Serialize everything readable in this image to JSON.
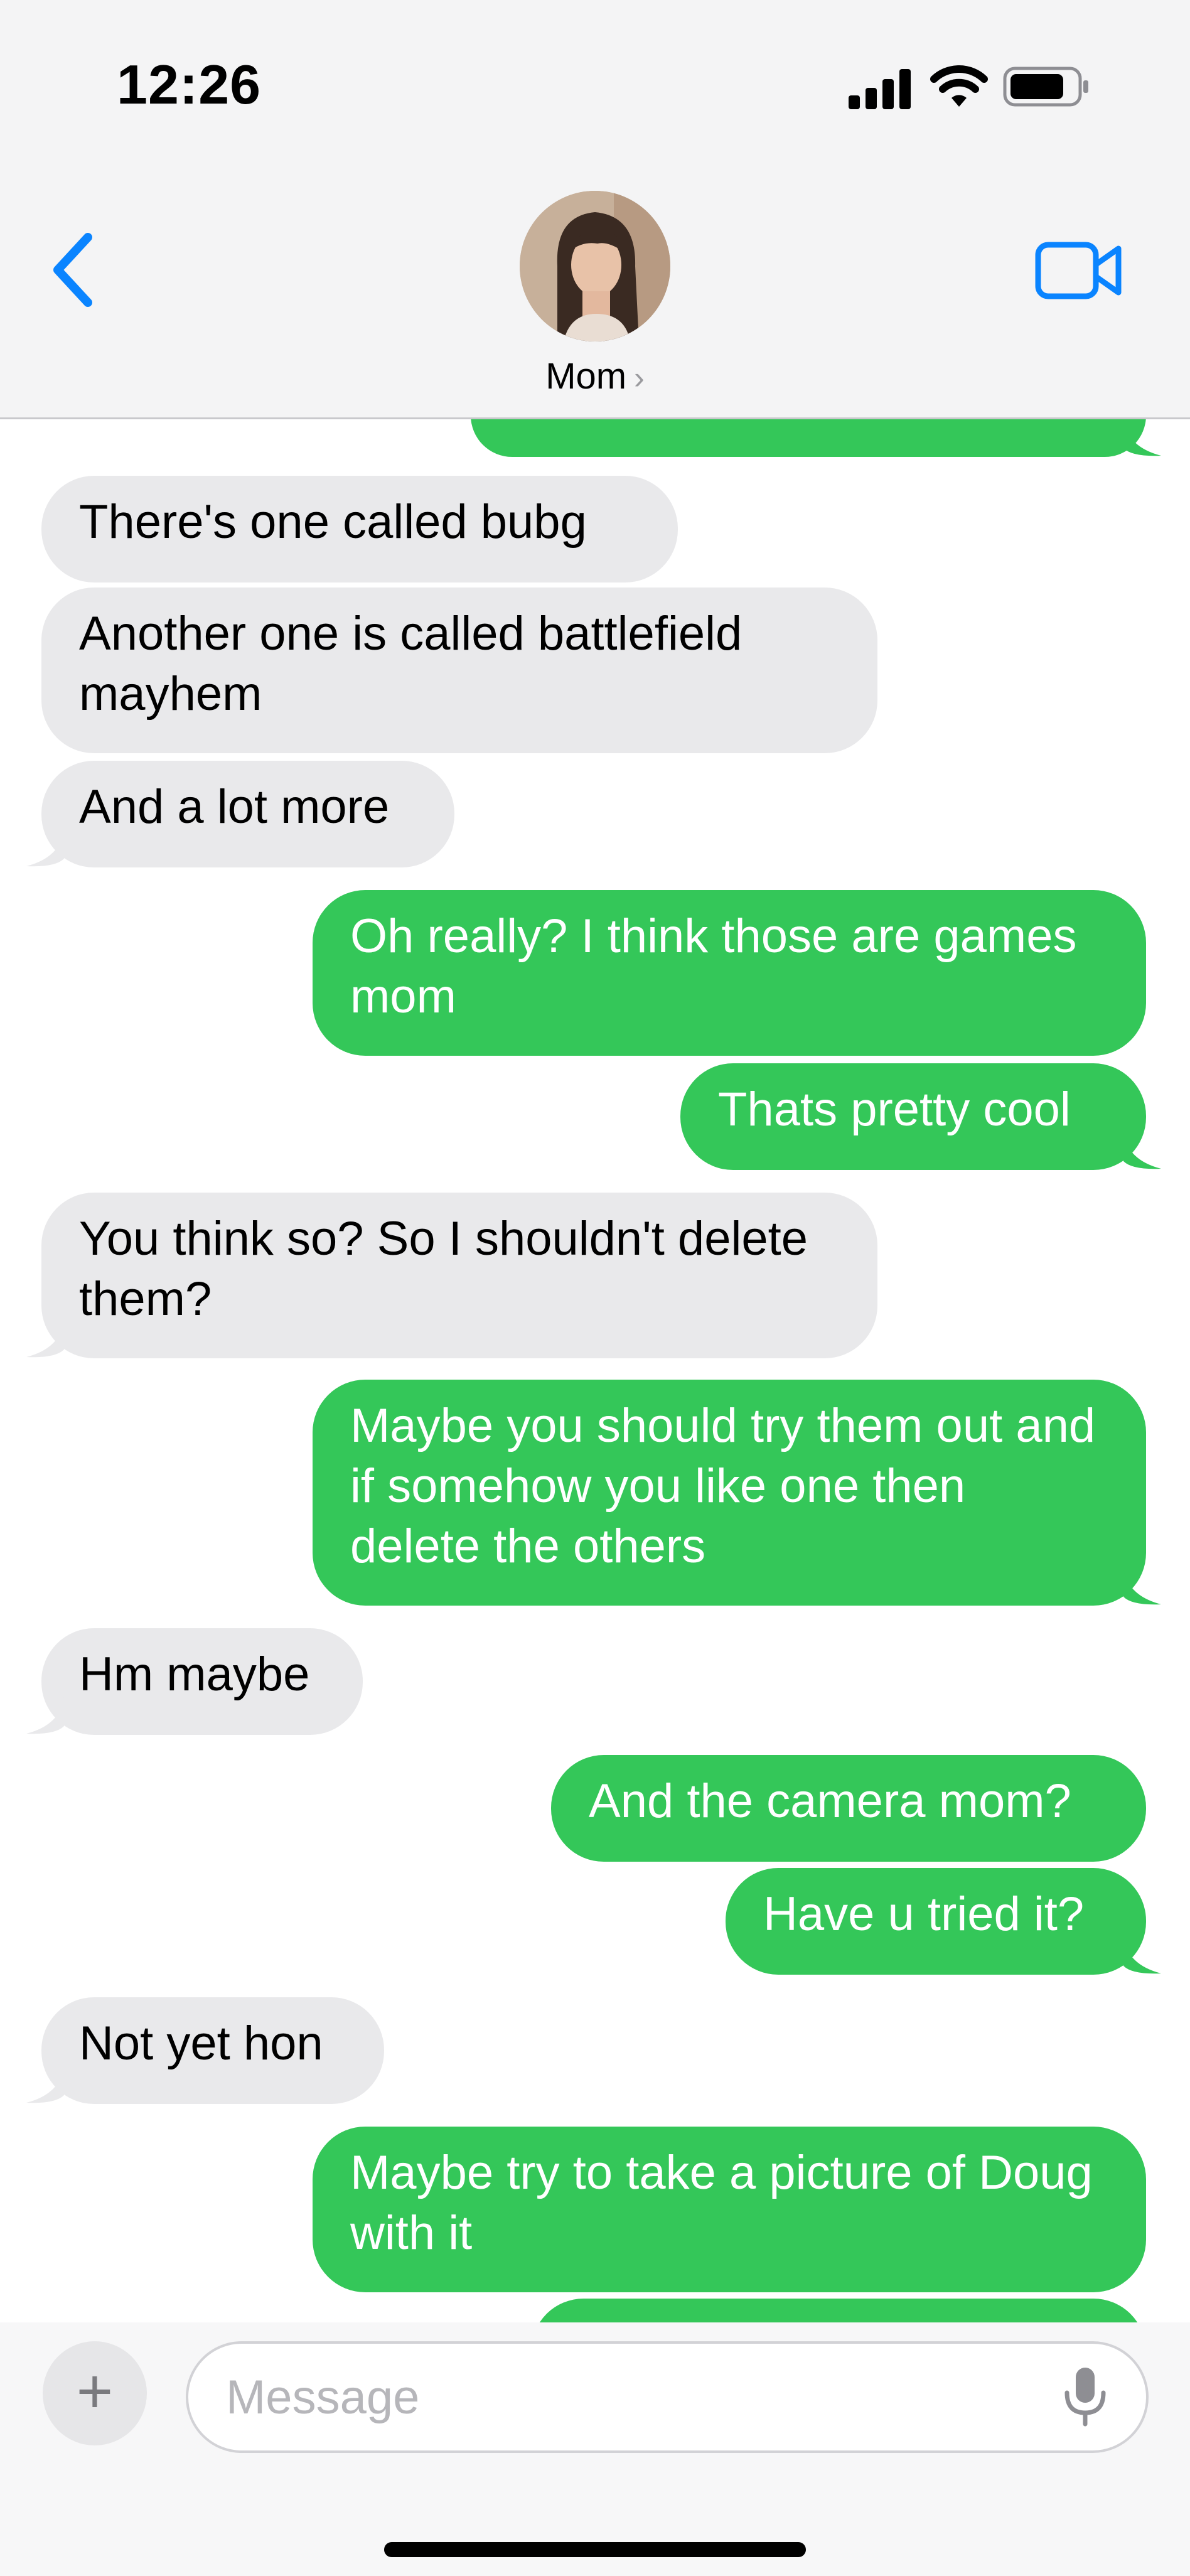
{
  "status_bar": {
    "time": "12:26",
    "icons": [
      "signal-icon",
      "wifi-icon",
      "battery-icon"
    ]
  },
  "header": {
    "back_icon": "chevron-left-icon",
    "contact_name": "Mom",
    "contact_chevron": "›",
    "video_icon": "video-camera-icon"
  },
  "messages": [
    {
      "direction": "sent",
      "text": ""
    },
    {
      "direction": "received",
      "text": "There's one called bubg"
    },
    {
      "direction": "received",
      "text": "Another one is called battlefield mayhem"
    },
    {
      "direction": "received",
      "text": "And a lot more"
    },
    {
      "direction": "sent",
      "text": "Oh really? I think those are games mom"
    },
    {
      "direction": "sent",
      "text": "Thats pretty cool"
    },
    {
      "direction": "received",
      "text": "You think so? So I shouldn't delete them?"
    },
    {
      "direction": "sent",
      "text": "Maybe you should try them out and if somehow you like one then delete the others"
    },
    {
      "direction": "received",
      "text": "Hm maybe"
    },
    {
      "direction": "sent",
      "text": "And the camera mom?"
    },
    {
      "direction": "sent",
      "text": "Have u tried it?"
    },
    {
      "direction": "received",
      "text": "Not yet hon"
    },
    {
      "direction": "sent",
      "text": "Maybe try to take a picture of Doug with it"
    },
    {
      "direction": "sent",
      "text": ""
    }
  ],
  "compose": {
    "plus_label": "+",
    "placeholder": "Message",
    "value": "",
    "mic_icon": "microphone-icon"
  },
  "colors": {
    "sent_bubble": "#34c759",
    "received_bubble": "#e9e9eb",
    "accent": "#0a84ff",
    "bar_background": "#f4f4f5"
  }
}
